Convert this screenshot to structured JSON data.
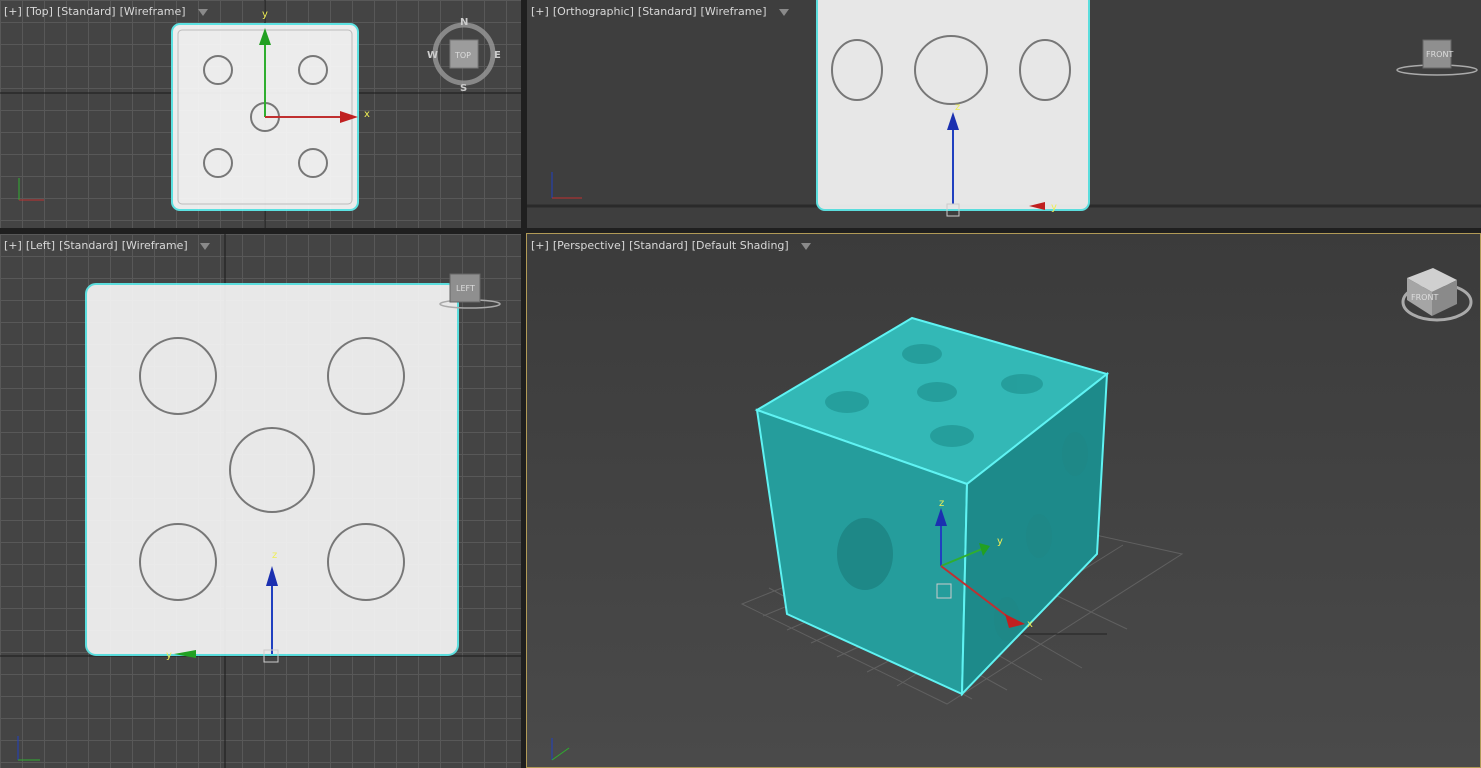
{
  "viewports": {
    "top": {
      "labels": [
        "[+]",
        "[Top]",
        "[Standard]",
        "[Wireframe]"
      ],
      "compass": {
        "n": "N",
        "s": "S",
        "e": "E",
        "w": "W",
        "cube_face": "TOP"
      },
      "axis": {
        "x": "x",
        "y": "y"
      }
    },
    "ortho": {
      "labels": [
        "[+]",
        "[Orthographic]",
        "[Standard]",
        "[Wireframe]"
      ],
      "cube_face": "FRONT",
      "axis": {
        "z": "z",
        "y": "y"
      }
    },
    "left": {
      "labels": [
        "[+]",
        "[Left]",
        "[Standard]",
        "[Wireframe]"
      ],
      "cube_face": "LEFT",
      "axis": {
        "z": "z",
        "y": "y"
      }
    },
    "perspective": {
      "labels": [
        "[+]",
        "[Perspective]",
        "[Standard]",
        "[Default Shading]"
      ],
      "cube_face": "FRONT",
      "axis": {
        "x": "x",
        "y": "y",
        "z": "z"
      }
    }
  },
  "colors": {
    "dice": "#2aa9a9",
    "dice_dark": "#1b7f80",
    "selection": "#5ff3f3",
    "wire": "#ffffff",
    "viewport_bg": "#444444",
    "active_border": "#b19a56"
  }
}
